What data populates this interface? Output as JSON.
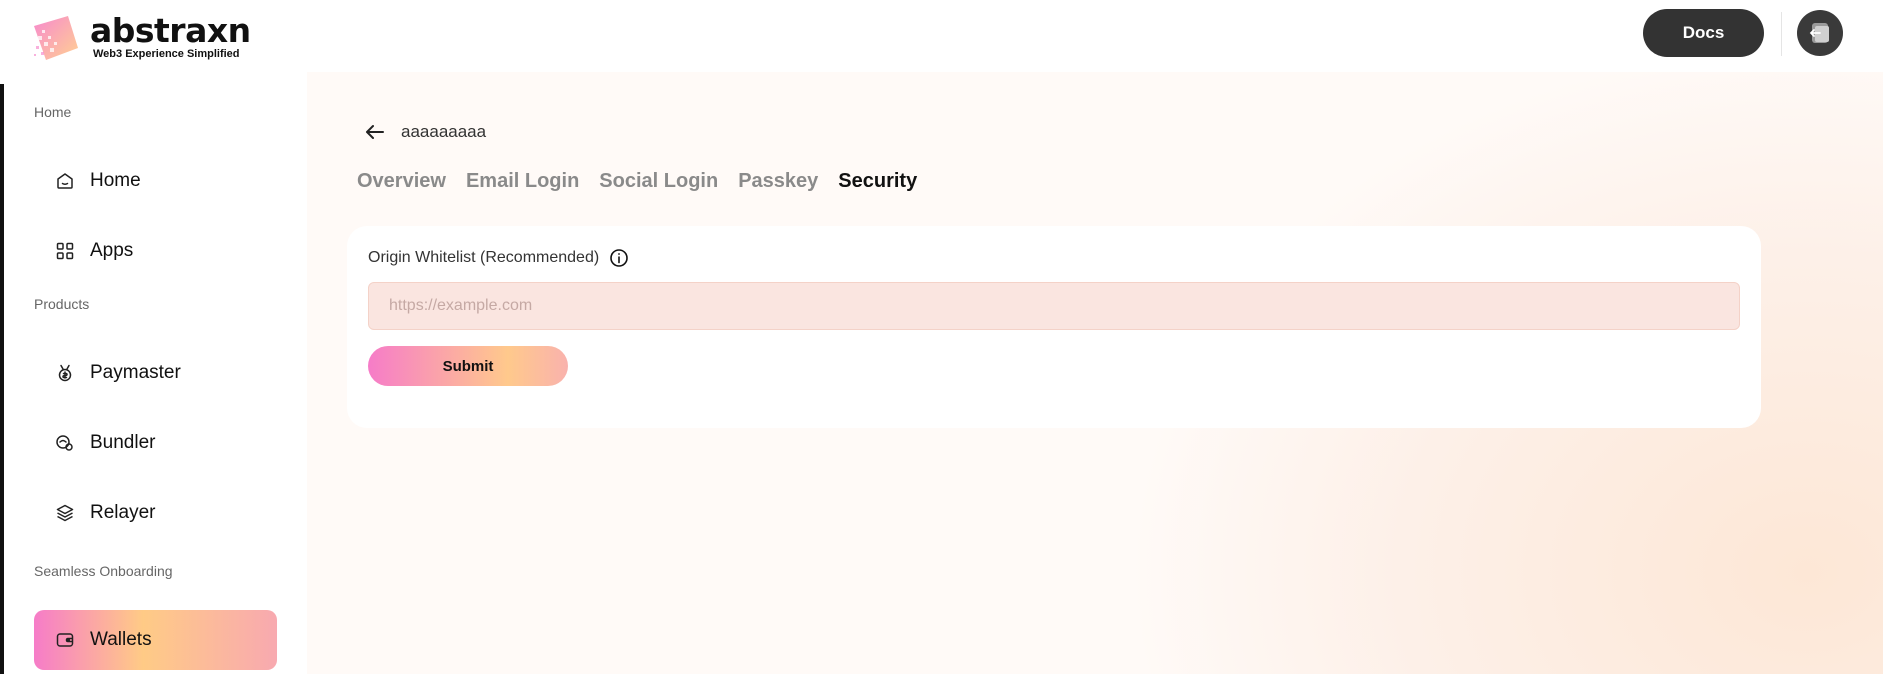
{
  "brand": {
    "name": "abstraxn",
    "tagline": "Web3 Experience Simplified"
  },
  "header": {
    "docs_label": "Docs"
  },
  "sidebar": {
    "sections": [
      {
        "label": "Home"
      },
      {
        "label": "Products"
      },
      {
        "label": "Seamless Onboarding"
      }
    ],
    "items": [
      {
        "label": "Home",
        "icon": "home-icon"
      },
      {
        "label": "Apps",
        "icon": "apps-grid-icon"
      },
      {
        "label": "Paymaster",
        "icon": "paymaster-icon"
      },
      {
        "label": "Bundler",
        "icon": "bundler-icon"
      },
      {
        "label": "Relayer",
        "icon": "layers-icon"
      },
      {
        "label": "Wallets",
        "icon": "wallet-icon",
        "active": true
      }
    ]
  },
  "main": {
    "app_name": "aaaaaaaaa",
    "tabs": [
      {
        "label": "Overview"
      },
      {
        "label": "Email Login"
      },
      {
        "label": "Social Login"
      },
      {
        "label": "Passkey"
      },
      {
        "label": "Security",
        "active": true
      }
    ],
    "security": {
      "field_label": "Origin Whitelist (Recommended)",
      "input_value": "",
      "input_placeholder": "https://example.com",
      "submit_label": "Submit"
    }
  },
  "colors": {
    "accent_pink": "#f67cc8",
    "accent_orange": "#ffcb86",
    "dark_button": "#333333"
  }
}
